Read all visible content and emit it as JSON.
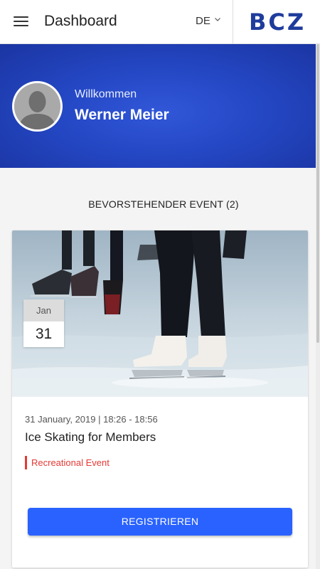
{
  "header": {
    "title": "Dashboard",
    "language": "DE",
    "logo": "BCZ"
  },
  "hero": {
    "welcome": "Willkommen",
    "user_name": "Werner Meier"
  },
  "events": {
    "section_title": "BEVORSTEHENDER EVENT (2)",
    "items": [
      {
        "month": "Jan",
        "day": "31",
        "meta": "31 January, 2019 | 18:26 - 18:56",
        "name": "Ice Skating for Members",
        "category": "Recreational Event",
        "register_label": "REGISTRIEREN",
        "image": "ice-skating-photo"
      }
    ]
  },
  "colors": {
    "accent": "#2962ff",
    "hero": "#2447c4",
    "logo": "#1e3c9c",
    "tag": "#e53935"
  },
  "icons": {
    "menu": "hamburger-menu-icon",
    "language": "chevron-down-icon",
    "avatar": "user-avatar-placeholder"
  }
}
